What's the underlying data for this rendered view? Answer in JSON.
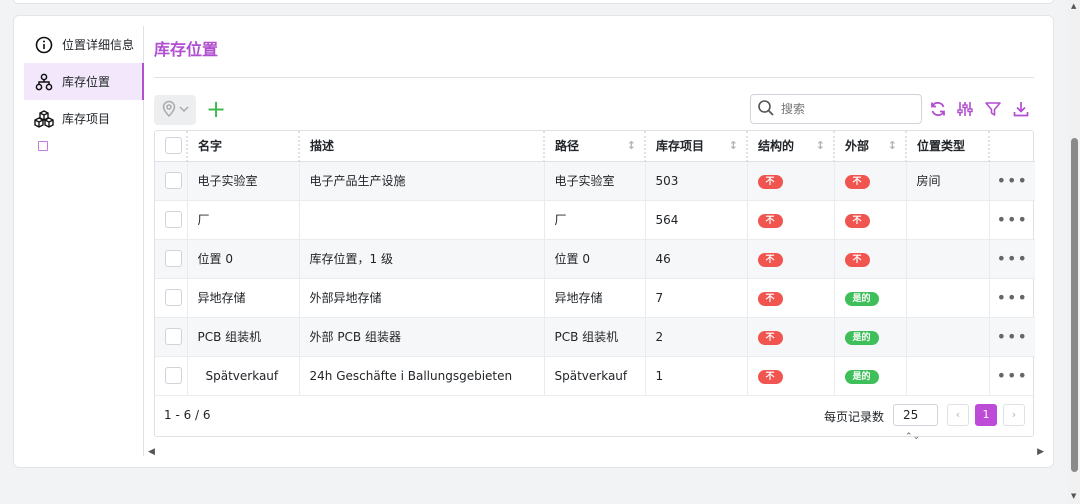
{
  "sidebar": {
    "items": [
      {
        "label": "位置详细信息",
        "icon": "info-circle-icon"
      },
      {
        "label": "库存位置",
        "icon": "sitemap-icon",
        "active": true
      },
      {
        "label": "库存项目",
        "icon": "packages-icon"
      }
    ]
  },
  "main": {
    "title": "库存位置"
  },
  "toolbar": {
    "search_placeholder": "搜索",
    "add_label": "+"
  },
  "table": {
    "columns": [
      "名字",
      "描述",
      "路径",
      "库存项目",
      "结构的",
      "外部",
      "位置类型"
    ],
    "rows": [
      {
        "name": "电子实验室",
        "description": "电子产品生产设施",
        "path": "电子实验室",
        "items": "503",
        "structural": "不",
        "external": "不",
        "type": "房间"
      },
      {
        "name": "厂",
        "description": "",
        "path": "厂",
        "items": "564",
        "structural": "不",
        "external": "不",
        "type": ""
      },
      {
        "name": "位置 0",
        "description": "库存位置，1 级",
        "path": "位置 0",
        "items": "46",
        "structural": "不",
        "external": "不",
        "type": ""
      },
      {
        "name": "异地存储",
        "description": "外部异地存储",
        "path": "异地存储",
        "items": "7",
        "structural": "不",
        "external": "是的",
        "type": ""
      },
      {
        "name": "PCB 组装机",
        "description": "外部 PCB 组装器",
        "path": "PCB 组装机",
        "items": "2",
        "structural": "不",
        "external": "是的",
        "type": ""
      },
      {
        "name": "Spätverkauf",
        "description": "24h Geschäfte i Ballungsgebieten",
        "path": "Spätverkauf",
        "items": "1",
        "structural": "不",
        "external": "是的",
        "type": ""
      }
    ]
  },
  "footer": {
    "count": "1 - 6 / 6",
    "records_per_page_label": "每页记录数",
    "records_per_page": "25",
    "current_page": "1",
    "prev": "‹",
    "next": "›"
  },
  "colors": {
    "accent": "#b04fd0",
    "no": "#f0554f",
    "yes": "#3fbf5a",
    "add": "#3fb950"
  }
}
